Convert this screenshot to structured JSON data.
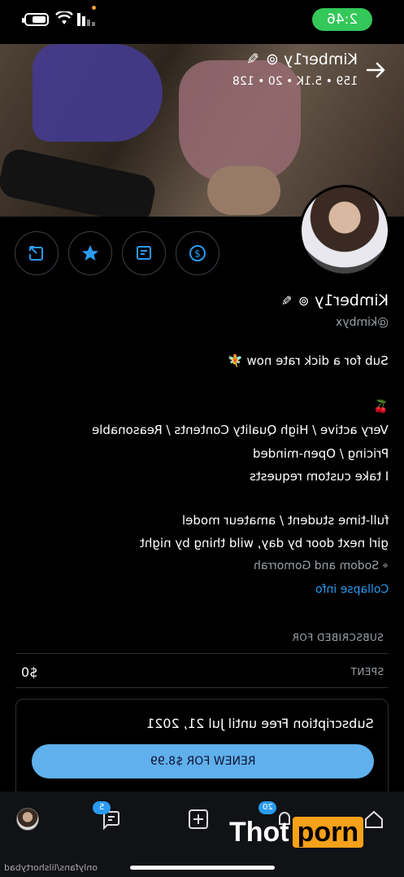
{
  "status_bar": {
    "time": "2:46"
  },
  "header": {
    "name": "Kimber1y",
    "stats": "159 • 5.1K • 20 • 128"
  },
  "profile": {
    "name": "Kimber1y",
    "handle": "@kimbyx",
    "bio": [
      "Sub for a dick rate now 🧚",
      "🍒",
      "Very active / High Quality Contents / Reasonable",
      "Pricing / Open-minded",
      "I take custom requests",
      "full-time student / amateur model",
      "girl next door by day, wild thing by night"
    ],
    "location": "Sodom and Gomorrah",
    "collapse_label": "Collapse info"
  },
  "subscription": {
    "subscribed_for_label": "SUBSCRIBED FOR",
    "spent_label": "SPENT",
    "spent_value": "$0",
    "card_title": "Subscription Free until Jul 21, 2021",
    "renew_label": "RENEW FOR $8.99"
  },
  "bottom_nav": {
    "messages_badge": "5",
    "notifications_badge": "20"
  },
  "watermark": {
    "part1": "Thot",
    "part2": "porn"
  },
  "footer": {
    "text": "onlyfans/lilshortybad"
  },
  "colors": {
    "accent": "#2a9bf0",
    "renew_button": "#5fb0ec",
    "background": "#000000"
  }
}
